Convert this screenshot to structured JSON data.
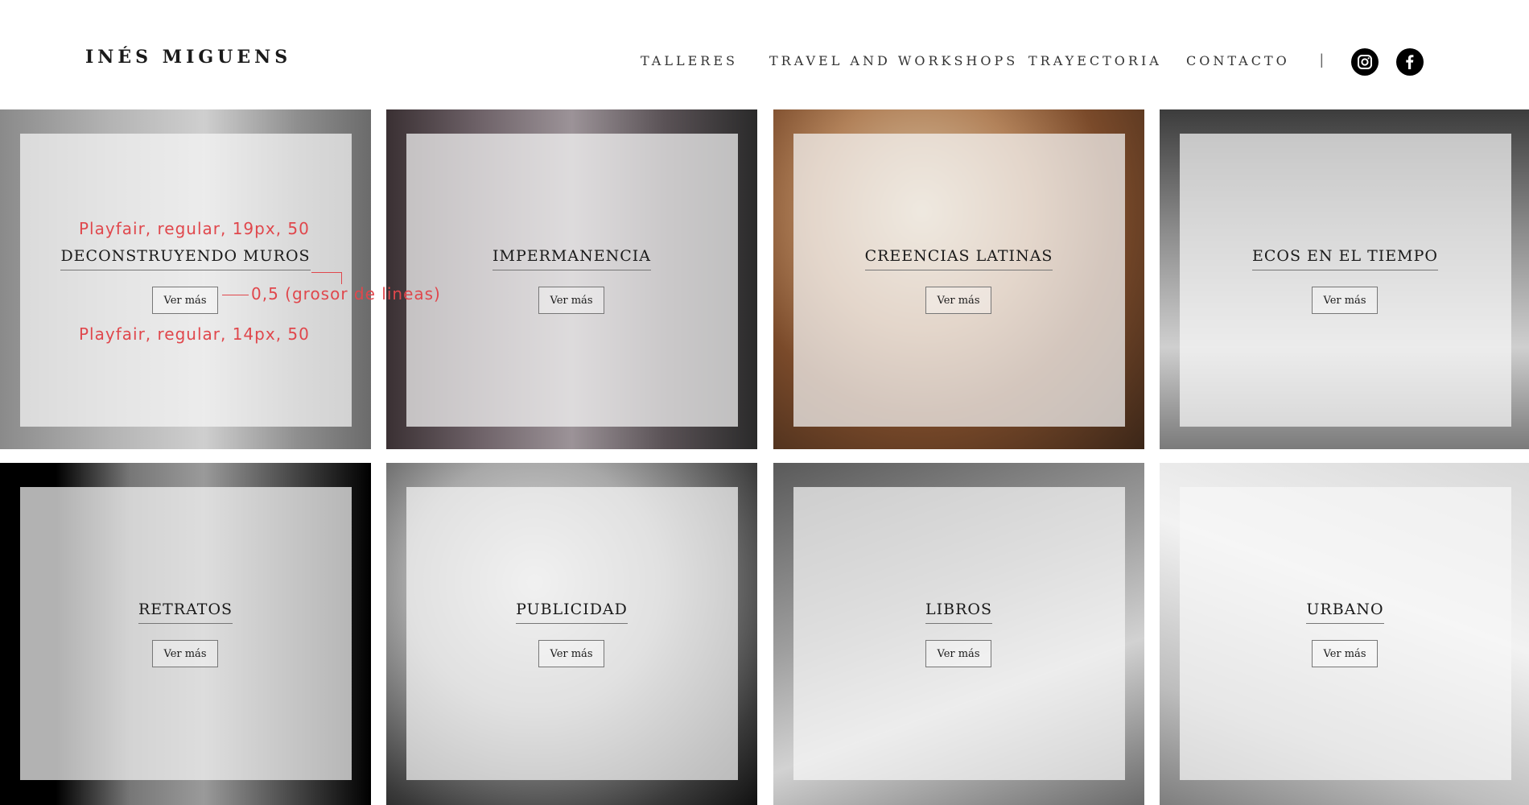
{
  "header": {
    "brand": "INÉS MIGUENS",
    "nav": [
      "TALLERES",
      "TRAVEL AND WORKSHOPS",
      "TRAYECTORIA",
      "CONTACTO"
    ],
    "divider": "|",
    "social": [
      "instagram-icon",
      "facebook-icon"
    ]
  },
  "tiles": [
    {
      "title": "DECONSTRUYENDO MUROS",
      "button": "Ver más"
    },
    {
      "title": "IMPERMANENCIA",
      "button": "Ver más"
    },
    {
      "title": "CREENCIAS LATINAS",
      "button": "Ver más"
    },
    {
      "title": "ECOS EN EL TIEMPO",
      "button": "Ver más"
    },
    {
      "title": "RETRATOS",
      "button": "Ver más"
    },
    {
      "title": "PUBLICIDAD",
      "button": "Ver más"
    },
    {
      "title": "LIBROS",
      "button": "Ver más"
    },
    {
      "title": "URBANO",
      "button": "Ver más"
    }
  ],
  "annotations": {
    "title_spec": "Playfair, regular, 19px, 50",
    "line_spec": "0,5 (grosor de lineas)",
    "button_spec": "Playfair, regular, 14px, 50",
    "color": "#e0474c"
  }
}
